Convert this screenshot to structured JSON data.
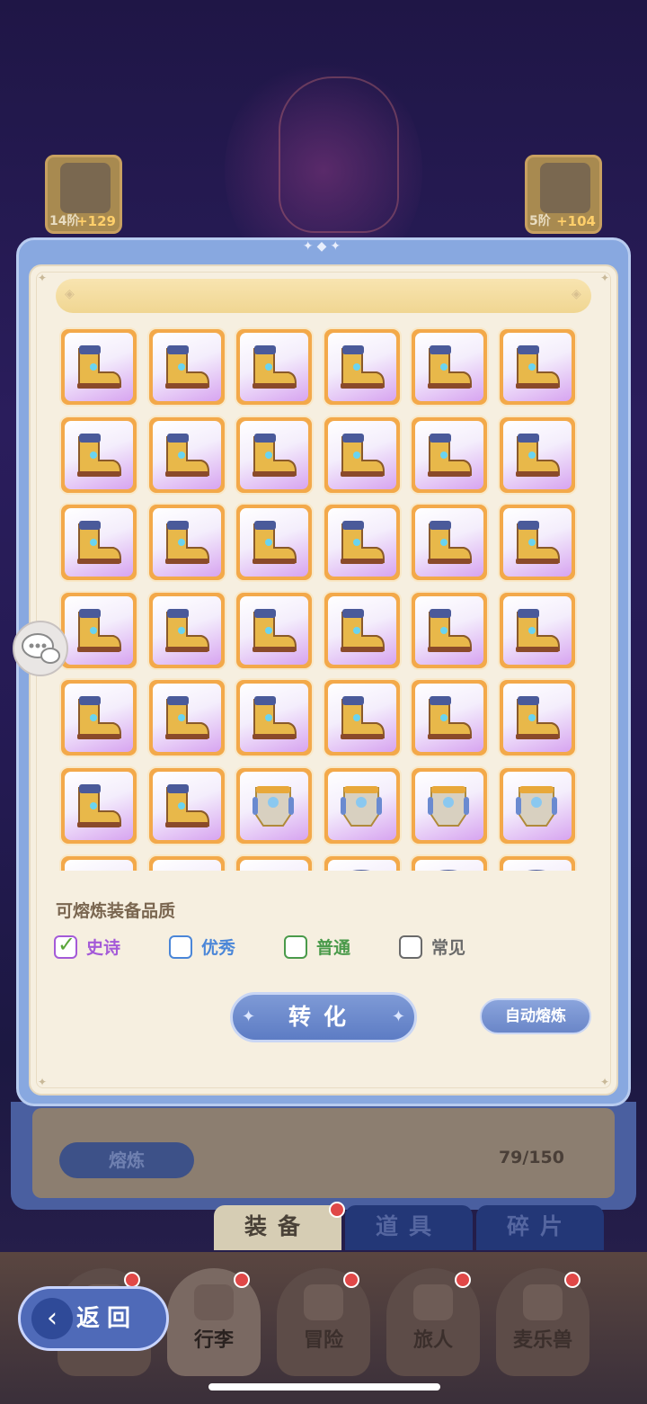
{
  "top_slots": [
    {
      "level": "14阶",
      "bonus": "+129",
      "icon": "staff-icon"
    },
    {
      "level": "5阶",
      "bonus": "+104",
      "icon": "helmet-icon"
    }
  ],
  "modal": {
    "quality_label": "可熔炼装备品质",
    "options": [
      {
        "label": "史诗",
        "checked": true,
        "color": "#a45ad8"
      },
      {
        "label": "优秀",
        "checked": false,
        "color": "#4a86d8"
      },
      {
        "label": "普通",
        "checked": false,
        "color": "#4a9a4a"
      },
      {
        "label": "常见",
        "checked": false,
        "color": "#6a6a6a"
      }
    ],
    "convert_label": "转化",
    "auto_label": "自动熔炼",
    "grid_items": [
      "boots",
      "boots",
      "boots",
      "boots",
      "boots",
      "boots",
      "boots",
      "boots",
      "boots",
      "boots",
      "boots",
      "boots",
      "boots",
      "boots",
      "boots",
      "boots",
      "boots",
      "boots",
      "boots",
      "boots",
      "boots",
      "boots",
      "boots",
      "boots",
      "boots",
      "boots",
      "boots",
      "boots",
      "boots",
      "boots",
      "boots",
      "boots",
      "armor",
      "armor",
      "armor",
      "armor",
      "ring",
      "ring",
      "ring",
      "gloves",
      "gloves",
      "gloves"
    ]
  },
  "panel": {
    "smelt_label": "熔炼",
    "count": "79/150"
  },
  "tabs": [
    {
      "label": "装备"
    },
    {
      "label": "道具"
    },
    {
      "label": "碎片"
    }
  ],
  "nav": [
    {
      "label": ""
    },
    {
      "label": "行李"
    },
    {
      "label": "冒险"
    },
    {
      "label": "旅人"
    },
    {
      "label": "麦乐兽"
    }
  ],
  "back_label": "返回"
}
